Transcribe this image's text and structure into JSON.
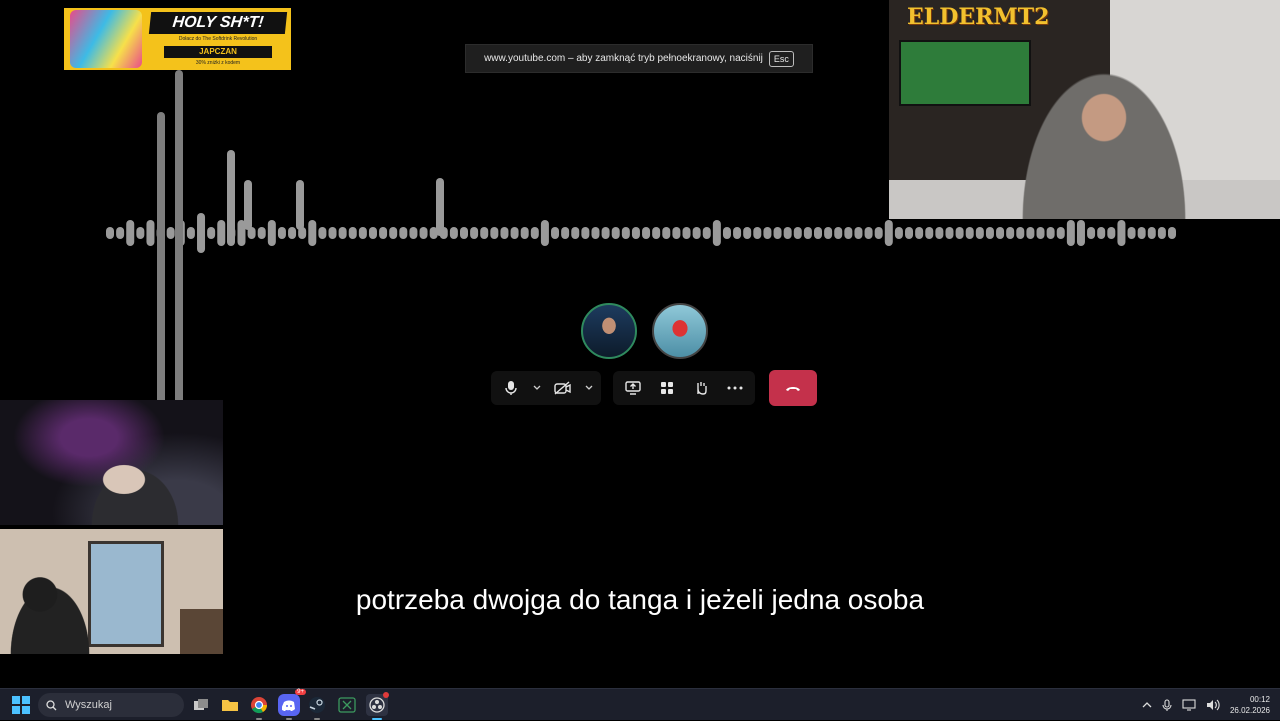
{
  "sponsor": {
    "headline": "HOLY SH*T!",
    "subline": "Dołacz do The Softdrink Revolution",
    "brand": "JAPCZAN",
    "promo": "30% zniżki z kodem"
  },
  "fullscreen_notice": {
    "text": "www.youtube.com – aby zamknąć tryb pełnoekranowy, naciśnij",
    "key": "Esc"
  },
  "overlay_logo": "ELDERMT2",
  "waveform": {
    "bar_heights": [
      1,
      1,
      2,
      1,
      2,
      1,
      1,
      2,
      1,
      3,
      1,
      2,
      1,
      2,
      1,
      1,
      2,
      1,
      1,
      1,
      2,
      1,
      1,
      1,
      1,
      1,
      1,
      1,
      1,
      1,
      1,
      1,
      1,
      1,
      1,
      1,
      1,
      1,
      1,
      1,
      1,
      1,
      1,
      2,
      1,
      1,
      1,
      1,
      1,
      1,
      1,
      1,
      1,
      1,
      1,
      1,
      1,
      1,
      1,
      1,
      2,
      1,
      1,
      1,
      1,
      1,
      1,
      1,
      1,
      1,
      1,
      1,
      1,
      1,
      1,
      1,
      1,
      2,
      1,
      1,
      1,
      1,
      1,
      1,
      1,
      1,
      1,
      1,
      1,
      1,
      1,
      1,
      1,
      1,
      1,
      2,
      2,
      1,
      1,
      1,
      2,
      1,
      1,
      1,
      1,
      1
    ],
    "tall_bars": [
      "long",
      "longest"
    ]
  },
  "call": {
    "participants": [
      "participant-1",
      "participant-2"
    ],
    "controls": [
      "mic",
      "mic-options",
      "camera",
      "camera-options",
      "share",
      "apps",
      "reactions",
      "more"
    ],
    "hangup_label": "Rozłącz"
  },
  "subtitle": "potrzeba dwojga do tanga i jeżeli jedna osoba",
  "taskbar": {
    "search_placeholder": "Wyszukaj",
    "discord_badge": "9+",
    "time": "00:12",
    "date": "26.02.2026"
  },
  "colors": {
    "hangup": "#c4314b",
    "taskbar": "#1c1f2b",
    "banner": "#f4c21b"
  }
}
